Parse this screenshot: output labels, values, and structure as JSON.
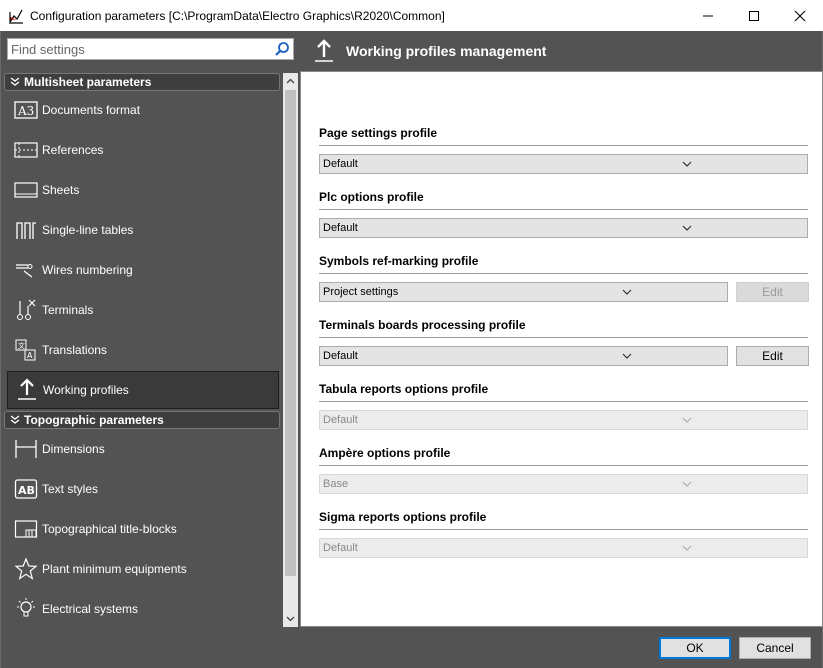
{
  "window": {
    "title": "Configuration parameters [C:\\ProgramData\\Electro Graphics\\R2020\\Common]",
    "icon": "app-logo-icon",
    "controls": [
      "minimize-icon",
      "maximize-icon",
      "close-icon"
    ]
  },
  "search": {
    "placeholder": "Find settings",
    "icon": "search-icon"
  },
  "sidebar": {
    "sections": [
      {
        "label": "Multisheet parameters",
        "icon": "chevron-collapse-icon"
      },
      {
        "label": "Topographic parameters",
        "icon": "chevron-collapse-icon"
      }
    ],
    "items": [
      {
        "label": "Documents format",
        "icon": "a3-format-icon",
        "selected": false
      },
      {
        "label": "References",
        "icon": "references-icon",
        "selected": false
      },
      {
        "label": "Sheets",
        "icon": "sheets-icon",
        "selected": false
      },
      {
        "label": "Single-line tables",
        "icon": "single-line-tables-icon",
        "selected": false
      },
      {
        "label": "Wires numbering",
        "icon": "wires-numbering-icon",
        "selected": false
      },
      {
        "label": "Terminals",
        "icon": "terminals-icon",
        "selected": false
      },
      {
        "label": "Translations",
        "icon": "translations-icon",
        "selected": false
      },
      {
        "label": "Working profiles",
        "icon": "upload-arrow-icon",
        "selected": true
      },
      {
        "label": "Dimensions",
        "icon": "dimensions-icon",
        "selected": false
      },
      {
        "label": "Text styles",
        "icon": "text-styles-icon",
        "selected": false
      },
      {
        "label": "Topographical title-blocks",
        "icon": "title-blocks-icon",
        "selected": false
      },
      {
        "label": "Plant minimum equipments",
        "icon": "star-icon",
        "selected": false
      },
      {
        "label": "Electrical systems",
        "icon": "lightbulb-icon",
        "selected": false
      }
    ]
  },
  "main": {
    "title": "Working profiles management",
    "icon": "upload-arrow-icon",
    "groups": [
      {
        "label": "Page settings profile",
        "value": "Default",
        "enabled": true
      },
      {
        "label": "Plc options profile",
        "value": "Default",
        "enabled": true
      },
      {
        "label": "Symbols ref-marking profile",
        "value": "Project settings",
        "enabled": true,
        "edit": "Edit",
        "edit_enabled": false
      },
      {
        "label": "Terminals boards processing profile",
        "value": "Default",
        "enabled": true,
        "edit": "Edit",
        "edit_enabled": true
      },
      {
        "label": "Tabula reports options profile",
        "value": "Default",
        "enabled": false
      },
      {
        "label": "Ampère options profile",
        "value": "Base",
        "enabled": false
      },
      {
        "label": "Sigma reports options profile",
        "value": "Default",
        "enabled": false
      }
    ]
  },
  "footer": {
    "ok_label": "OK",
    "cancel_label": "Cancel"
  },
  "colors": {
    "sidebar_bg": "#535353",
    "selected_item_bg": "#3a3a3a",
    "focus_blue": "#0078d7"
  }
}
